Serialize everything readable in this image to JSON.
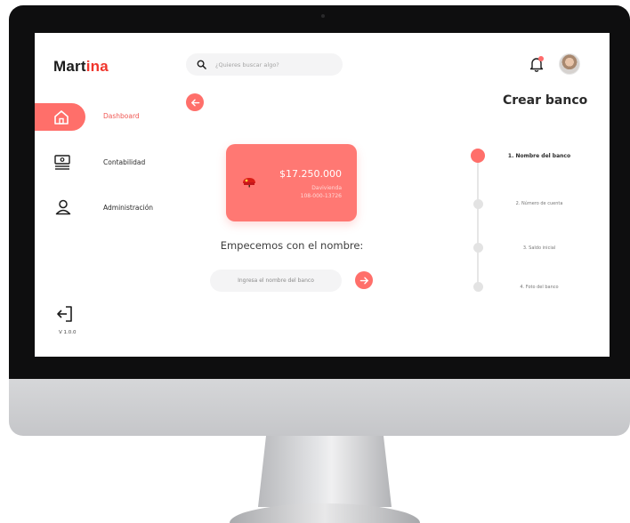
{
  "app": {
    "brand_prefix": "Mart",
    "brand_accent": "ina",
    "version": "V 1.0.0",
    "accent_color": "#ff6f6a"
  },
  "header": {
    "search_placeholder": "¿Quieres buscar algo?",
    "notification_icon": "bell-icon",
    "avatar_icon": "user-avatar"
  },
  "sidebar": {
    "items": [
      {
        "label": "Dashboard",
        "icon": "home-icon",
        "active": true
      },
      {
        "label": "Contabilidad",
        "icon": "cash-icon",
        "active": false
      },
      {
        "label": "Administración",
        "icon": "user-icon",
        "active": false
      }
    ],
    "logout_icon": "logout-icon"
  },
  "main": {
    "title": "Crear banco",
    "card": {
      "amount": "$17.250.000",
      "bank_name": "Davivienda",
      "account_number": "108-000-13726"
    },
    "prompt": "Empecemos con el nombre:",
    "name_input_placeholder": "Ingresa el nombre del banco"
  },
  "stepper": {
    "steps": [
      {
        "label": "1. Nombre del banco",
        "active": true
      },
      {
        "label": "2. Número de cuenta",
        "active": false
      },
      {
        "label": "3. Saldo inicial",
        "active": false
      },
      {
        "label": "4. Foto del banco",
        "active": false
      }
    ]
  }
}
